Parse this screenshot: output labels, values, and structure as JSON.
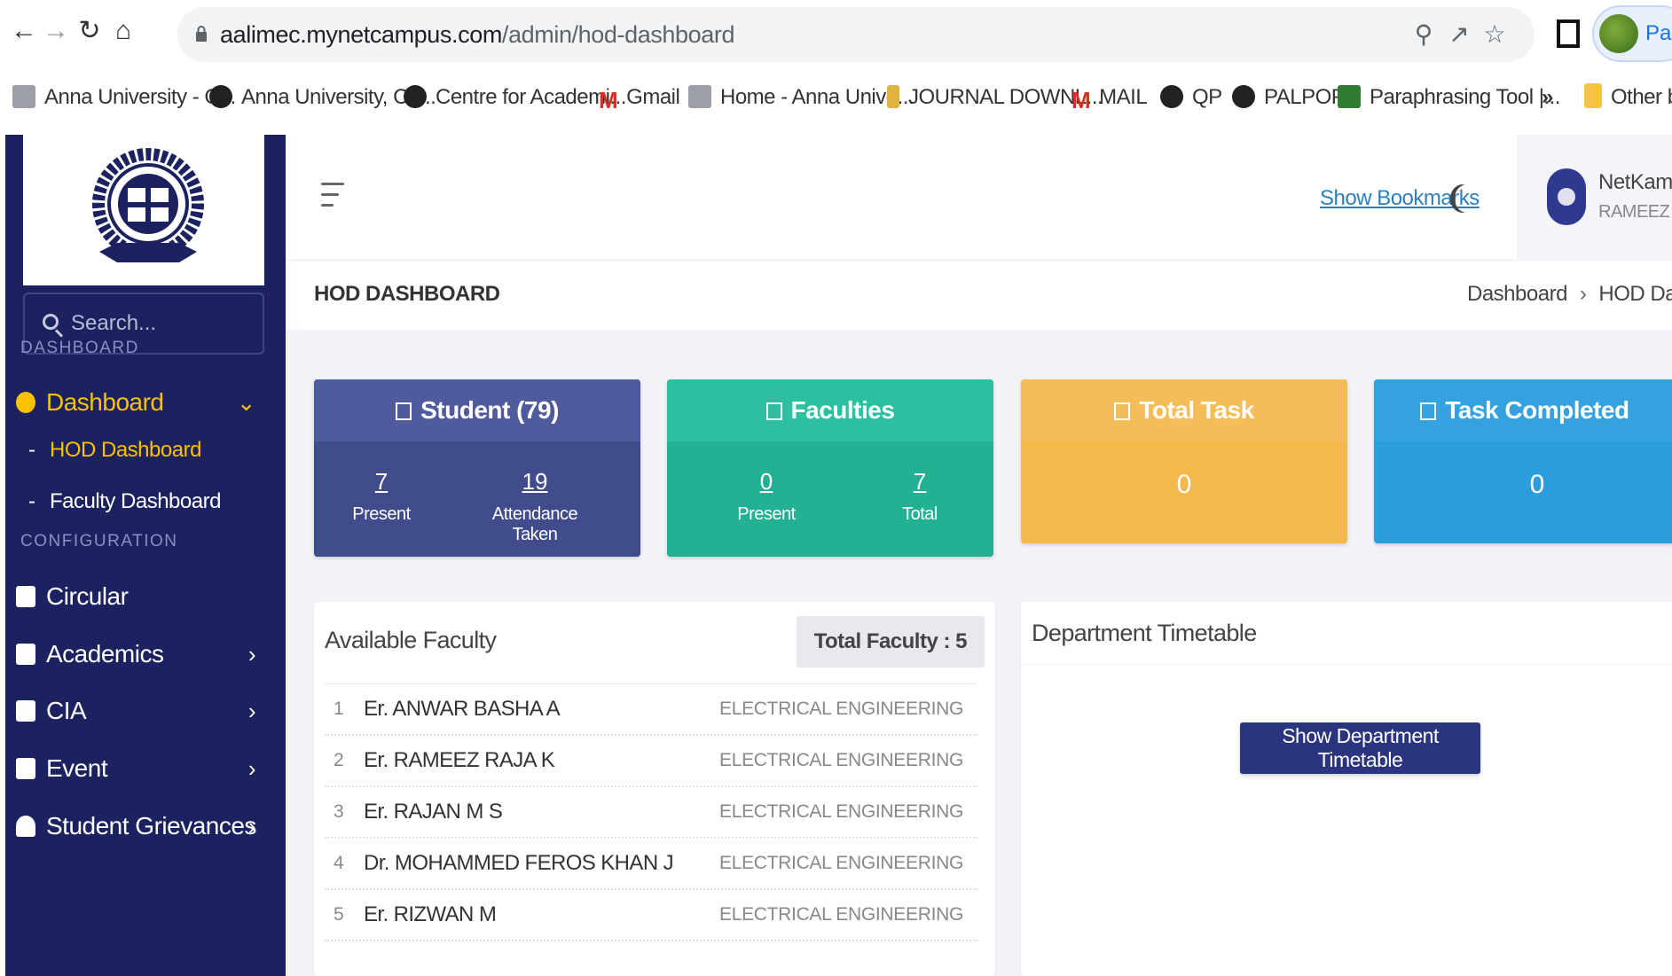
{
  "browser": {
    "url_host": "aalimec.mynetcampus.com",
    "url_path": "/admin/hod-dashboard",
    "profile_button": "Pause",
    "bookmarks": [
      {
        "label": "Anna University - C...",
        "icon": "anna-icon"
      },
      {
        "label": "Anna University, Ch...",
        "icon": "globe-icon"
      },
      {
        "label": "Centre for Academi...",
        "icon": "globe-icon"
      },
      {
        "label": "Gmail",
        "icon": "gmail-icon"
      },
      {
        "label": "Home - Anna Unive...",
        "icon": "anna-icon"
      },
      {
        "label": "JOURNAL DOWNL...",
        "icon": "journal-icon"
      },
      {
        "label": "MAIL",
        "icon": "gmail-icon"
      },
      {
        "label": "QP",
        "icon": "globe-icon"
      },
      {
        "label": "PALPOP",
        "icon": "globe-icon"
      },
      {
        "label": "Paraphrasing Tool |...",
        "icon": "paraphrase-icon"
      }
    ],
    "overflow": "»",
    "other_bookmarks": "Other b"
  },
  "sidebar": {
    "search_placeholder": "Search...",
    "section_dashboard": "DASHBOARD",
    "dashboard_label": "Dashboard",
    "sub_items": [
      "HOD Dashboard",
      "Faculty Dashboard"
    ],
    "section_configuration": "CONFIGURATION",
    "config_items": [
      {
        "label": "Circular",
        "icon": "speaker-icon",
        "has_chevron": false
      },
      {
        "label": "Academics",
        "icon": "graduation-cap-icon",
        "has_chevron": true
      },
      {
        "label": "CIA",
        "icon": "calendar-clock-icon",
        "has_chevron": true
      },
      {
        "label": "Event",
        "icon": "calendar-icon",
        "has_chevron": true
      },
      {
        "label": "Student Grievances",
        "icon": "user-icon",
        "has_chevron": true
      }
    ]
  },
  "header": {
    "show_bookmarks": "Show Bookmarks",
    "user_name": "NetKampuss",
    "user_sub": "RAMEEZ RAJA"
  },
  "crumb": {
    "title": "HOD DASHBOARD",
    "items": [
      "Dashboard",
      "HOD Dashbo"
    ]
  },
  "cards": {
    "student": {
      "title": "Student (79)",
      "stats": [
        {
          "value": "7",
          "label": "Present"
        },
        {
          "value": "19",
          "label": "Attendance Taken"
        }
      ],
      "color": "#4a5596"
    },
    "faculties": {
      "title": "Faculties",
      "stats": [
        {
          "value": "0",
          "label": "Present"
        },
        {
          "value": "7",
          "label": "Total"
        }
      ],
      "color": "#26b99a"
    },
    "total_task": {
      "title": "Total Task",
      "value": "0",
      "color": "#f4b84c"
    },
    "task_completed": {
      "title": "Task Completed",
      "value": "0",
      "color": "#2d9cdb"
    }
  },
  "faculty_panel": {
    "title": "Available Faculty",
    "badge": "Total Faculty : 5",
    "rows": [
      {
        "idx": "1",
        "name": "Er. ANWAR BASHA A",
        "dept": "ELECTRICAL ENGINEERING"
      },
      {
        "idx": "2",
        "name": "Er. RAMEEZ RAJA K",
        "dept": "ELECTRICAL ENGINEERING"
      },
      {
        "idx": "3",
        "name": "Er. RAJAN M S",
        "dept": "ELECTRICAL ENGINEERING"
      },
      {
        "idx": "4",
        "name": "Dr. MOHAMMED FEROS KHAN J",
        "dept": "ELECTRICAL ENGINEERING"
      },
      {
        "idx": "5",
        "name": "Er. RIZWAN M",
        "dept": "ELECTRICAL ENGINEERING"
      }
    ]
  },
  "timetable_panel": {
    "title": "Department Timetable",
    "button": "Show Department Timetable"
  }
}
